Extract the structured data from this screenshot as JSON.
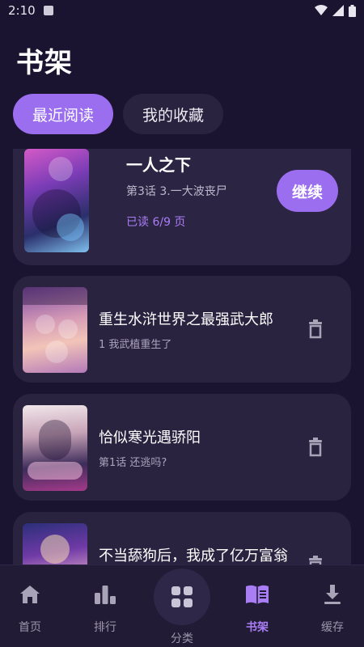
{
  "status_bar": {
    "time": "2:10"
  },
  "page_title": "书架",
  "tabs": [
    {
      "label": "最近阅读",
      "active": true
    },
    {
      "label": "我的收藏",
      "active": false
    }
  ],
  "featured": {
    "title": "一人之下",
    "subtitle": "第3话 3.一大波丧尸",
    "progress": "已读 6/9 页",
    "continue_label": "继续"
  },
  "items": [
    {
      "title": "重生水浒世界之最强武大郎",
      "subtitle": "1 我武植重生了"
    },
    {
      "title": "恰似寒光遇骄阳",
      "subtitle": "第1话 还逃吗?"
    },
    {
      "title": "不当舔狗后，我成了亿万富翁",
      "subtitle": ""
    }
  ],
  "bottom_nav": [
    {
      "label": "首页",
      "icon": "home-icon",
      "active": false
    },
    {
      "label": "排行",
      "icon": "bar-chart-icon",
      "active": false
    },
    {
      "label": "分类",
      "icon": "grid-icon",
      "active": false
    },
    {
      "label": "书架",
      "icon": "book-open-icon",
      "active": true
    },
    {
      "label": "缓存",
      "icon": "download-icon",
      "active": false
    }
  ],
  "colors": {
    "accent": "#9b6ef0",
    "background": "#1b1430",
    "card": "#2a2340"
  }
}
